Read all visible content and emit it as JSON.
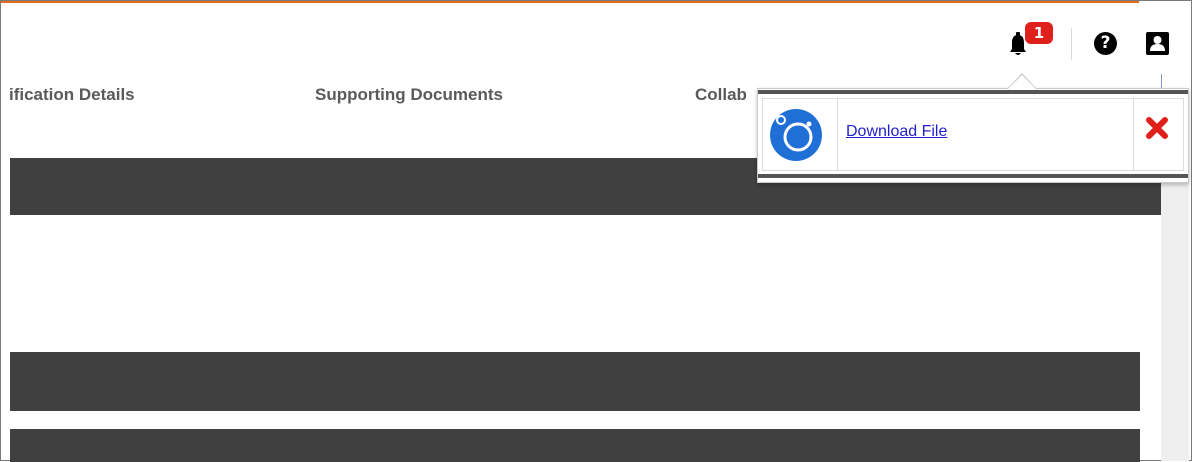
{
  "header": {
    "notification_count": "1",
    "help_icon": "question-circle-icon",
    "user_icon": "user-profile-icon",
    "bell_icon": "bell-icon"
  },
  "tabs": [
    {
      "label": "ification Details"
    },
    {
      "label": "Supporting Documents"
    },
    {
      "label": "Collab"
    }
  ],
  "notification_popup": {
    "item": {
      "icon": "app-logo-icon",
      "link_label": "Download File",
      "close_icon": "close-x-icon"
    }
  },
  "colors": {
    "accent": "#e36c1f",
    "badge": "#e0201a",
    "bar": "#404040",
    "close": "#e0201a",
    "logo": "#1f6fd6"
  }
}
